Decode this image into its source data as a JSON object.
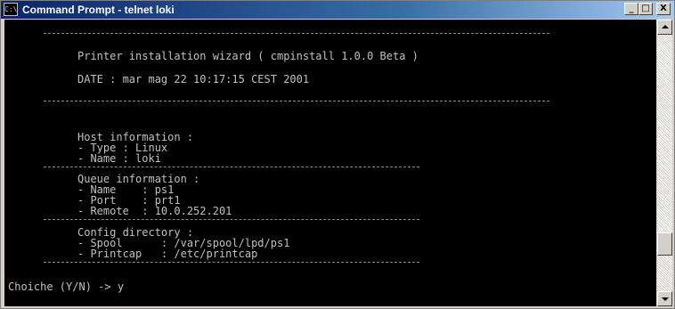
{
  "window": {
    "title": "Command Prompt - telnet loki",
    "icon_label": "C:\\",
    "controls": {
      "minimize": "_",
      "maximize": "□",
      "close": "X"
    }
  },
  "console": {
    "wizard_title": "Printer installation wizard ( cmpinstall 1.0.0 Beta )",
    "date_line": "DATE : mar mag 22 10:17:15 CEST 2001",
    "host": {
      "header": "Host information :",
      "lines": [
        "- Type : Linux",
        "- Name : loki"
      ]
    },
    "queue": {
      "header": "Queue information :",
      "lines": [
        "- Name    : ps1",
        "- Port    : prt1",
        "- Remote  : 10.0.252.201"
      ]
    },
    "config": {
      "header": "Config directory :",
      "lines": [
        "- Spool      : /var/spool/lpd/ps1",
        "- Printcap   : /etc/printcap"
      ]
    },
    "prompt": "Choiche (Y/N) -> y"
  },
  "colors": {
    "console_bg": "#000000",
    "console_text": "#c0c0c0",
    "titlebar_start": "#0a246a",
    "titlebar_end": "#a6caf0"
  }
}
